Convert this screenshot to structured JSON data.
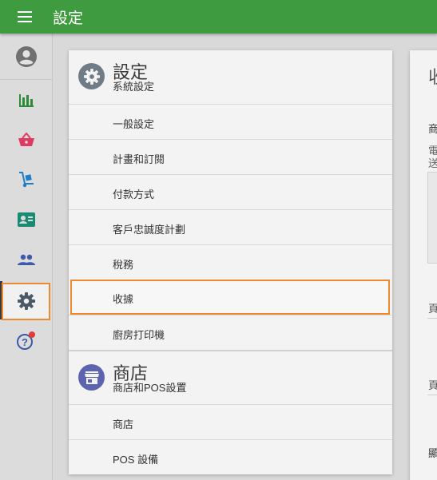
{
  "topbar": {
    "title": "設定",
    "menu_icon": "menu-icon",
    "color": "#3f9b3f"
  },
  "sidebar": {
    "items": [
      {
        "name": "account",
        "icon": "account-circle-icon"
      },
      {
        "name": "reports",
        "icon": "bar-chart-icon"
      },
      {
        "name": "sales",
        "icon": "shopping-basket-icon"
      },
      {
        "name": "inventory",
        "icon": "hand-truck-icon"
      },
      {
        "name": "customers-card",
        "icon": "contact-card-icon"
      },
      {
        "name": "employees",
        "icon": "people-icon"
      },
      {
        "name": "settings",
        "icon": "gear-icon",
        "active": true
      },
      {
        "name": "help",
        "icon": "help-icon",
        "badge": true
      }
    ],
    "active_color": "#ee8a32"
  },
  "settings_panel": {
    "system": {
      "title": "設定",
      "subtitle": "系統設定",
      "icon": "gear-icon",
      "items": [
        "一般設定",
        "計畫和訂閱",
        "付款方式",
        "客戶忠誠度計劃",
        "稅務",
        "收據",
        "廚房打印機"
      ],
      "selected": "收據"
    },
    "store": {
      "title": "商店",
      "subtitle": "商店和POS設置",
      "icon": "store-icon",
      "items": [
        "商店",
        "POS 設備"
      ]
    }
  },
  "right_panel": {
    "heading": "收",
    "label_1": "商",
    "text_1": "電",
    "text_2": "送",
    "label_2": "頁",
    "label_3": "頁",
    "label_4": "顯"
  }
}
